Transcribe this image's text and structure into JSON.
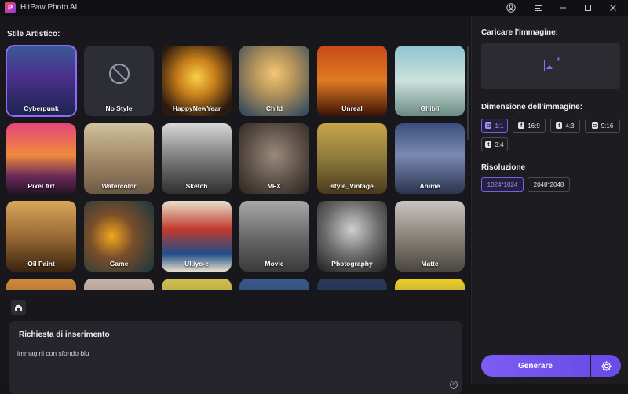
{
  "app": {
    "title": "HitPaw Photo AI"
  },
  "styles": {
    "section_title": "Stile Artistico:",
    "items": [
      {
        "label": "Cyberpunk",
        "bg": "linear-gradient(180deg,#3a5a9a 0%,#4a2f8a 45%,#1c2450 100%)",
        "selected": true
      },
      {
        "label": "No Style",
        "bg": "#2d2d36",
        "selected": false
      },
      {
        "label": "HappyNewYear",
        "bg": "radial-gradient(circle at 50% 45%,#f7d04a 0%,#c9801a 35%,#2a1a10 80%)",
        "selected": false
      },
      {
        "label": "Child",
        "bg": "radial-gradient(circle at 50% 40%,#f3c774 0%,#b0905a 40%,#3a4e5c 90%)",
        "selected": false
      },
      {
        "label": "Unreal",
        "bg": "linear-gradient(180deg,#c84a1a 0%,#e07a22 50%,#3a1206 100%)",
        "selected": false
      },
      {
        "label": "Ghibli",
        "bg": "linear-gradient(180deg,#8fc4cf 0%,#cbe1dc 50%,#6a8b82 100%)",
        "selected": false
      },
      {
        "label": "Pixel Art",
        "bg": "linear-gradient(180deg,#e5467a 0%,#f08a3c 45%,#6a2a5a 75%,#261426 100%)",
        "selected": false
      },
      {
        "label": "Watercolor",
        "bg": "linear-gradient(180deg,#cfc3a0 0%,#a4886a 50%,#6b5a45 100%)",
        "selected": false
      },
      {
        "label": "Sketch",
        "bg": "linear-gradient(180deg,#d8d8d8 0%,#7a7a7a 50%,#2f2f2f 100%)",
        "selected": false
      },
      {
        "label": "VFX",
        "bg": "radial-gradient(circle at 50% 45%,#9a8a7a 0%,#5a4e46 55%,#2a2420 100%)",
        "selected": false
      },
      {
        "label": "style_Vintage",
        "bg": "linear-gradient(180deg,#c7a548 0%,#8e7a3c 50%,#4a3a1c 100%)",
        "selected": false
      },
      {
        "label": "Anime",
        "bg": "linear-gradient(180deg,#3a4e7e 0%,#7a8ab0 45%,#2a3450 100%)",
        "selected": false
      },
      {
        "label": "Oil Paint",
        "bg": "linear-gradient(180deg,#d8a65a 0%,#9a6a34 50%,#3a2410 100%)",
        "selected": false
      },
      {
        "label": "Game",
        "bg": "radial-gradient(circle at 40% 50%,#f0a81e 0%,#7a4e2a 40%,#2a3a3c 90%)",
        "selected": false
      },
      {
        "label": "Ukiyo-e",
        "bg": "linear-gradient(180deg,#e8e0cc 0%,#c23a2e 40%,#1e4e8a 75%,#e8e0cc 100%)",
        "selected": false
      },
      {
        "label": "Movie",
        "bg": "linear-gradient(180deg,#a8a8a8 0%,#6a6a6a 50%,#3a3a3a 100%)",
        "selected": false
      },
      {
        "label": "Photography",
        "bg": "radial-gradient(circle at 50% 40%,#cfcfcf 0%,#6a6a6a 50%,#1e1e1e 100%)",
        "selected": false
      },
      {
        "label": "Matte",
        "bg": "linear-gradient(180deg,#c8c4c0 0%,#8a847a 50%,#4a4640 100%)",
        "selected": false
      },
      {
        "label": "",
        "bg": "linear-gradient(180deg,#d08a3a 0%,#5a3420 100%)",
        "selected": false
      },
      {
        "label": "",
        "bg": "linear-gradient(180deg,#c8b4a8 0%,#6a5a52 100%)",
        "selected": false
      },
      {
        "label": "",
        "bg": "linear-gradient(180deg,#d0c050 0%,#6a5a20 100%)",
        "selected": false
      },
      {
        "label": "",
        "bg": "linear-gradient(180deg,#3a5a8a 0%,#1a2a44 100%)",
        "selected": false
      },
      {
        "label": "",
        "bg": "linear-gradient(180deg,#2a3a5a 0%,#121a2a 100%)",
        "selected": false
      },
      {
        "label": "",
        "bg": "linear-gradient(180deg,#f0d020 0%,#1a3a9a 100%)",
        "selected": false
      }
    ]
  },
  "prompt": {
    "title": "Richiesta di inserimento",
    "value": "immagini con sfondo blu"
  },
  "upload": {
    "label": "Caricare l'immagine:"
  },
  "dimension": {
    "label": "Dimensione dell'immagine:",
    "options": [
      {
        "label": "1:1",
        "icon": "instagram-icon",
        "glyph": "◘",
        "active": true
      },
      {
        "label": "16:9",
        "icon": "facebook-icon",
        "glyph": "f",
        "active": false
      },
      {
        "label": "4:3",
        "icon": "twitter-icon",
        "glyph": "t",
        "active": false
      },
      {
        "label": "9:16",
        "icon": "instagram-icon",
        "glyph": "◘",
        "active": false
      },
      {
        "label": "3:4",
        "icon": "twitter-icon",
        "glyph": "t",
        "active": false
      }
    ]
  },
  "resolution": {
    "label": "Risoluzione",
    "options": [
      {
        "label": "1024*1024",
        "active": true
      },
      {
        "label": "2048*2048",
        "active": false
      }
    ]
  },
  "generate": {
    "label": "Generare"
  },
  "colors": {
    "accent": "#7b5cf0",
    "background": "#18181c",
    "panel": "#1c1c21"
  }
}
